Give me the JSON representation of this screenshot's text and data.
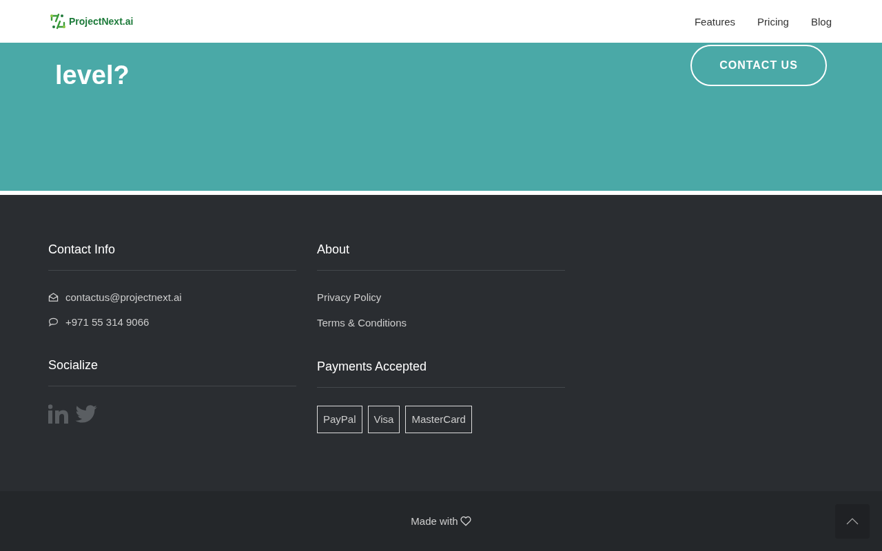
{
  "header": {
    "logo": "ProjectNext.ai",
    "nav": [
      "Features",
      "Pricing",
      "Blog"
    ]
  },
  "cta": {
    "heading": "level?",
    "button": "CONTACT US"
  },
  "footer": {
    "contact_info": {
      "title": "Contact Info",
      "items": [
        {
          "kind": "email",
          "text": "contactus@projectnext.ai"
        },
        {
          "kind": "phone",
          "text": "+971 55 314 9066"
        }
      ]
    },
    "socialize": {
      "title": "Socialize",
      "links": [
        {
          "kind": "linkedin"
        },
        {
          "kind": "twitter"
        }
      ]
    },
    "about": {
      "title": "About",
      "links": [
        "Privacy Policy",
        "Terms & Conditions"
      ]
    },
    "payments": {
      "title": "Payments Accepted",
      "methods": [
        "PayPal",
        "Visa",
        "MasterCard"
      ]
    }
  },
  "bottom_bar": {
    "text": "Made with"
  }
}
